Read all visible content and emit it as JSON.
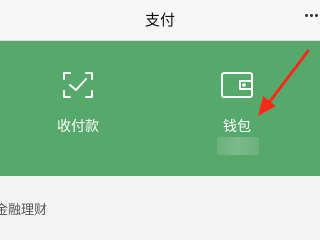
{
  "header": {
    "title": "支付",
    "more_icon": "more-dots-icon"
  },
  "colors": {
    "panel_background": "#57a86b",
    "arrow": "#ff2a1a"
  },
  "tiles": [
    {
      "label": "收付款",
      "icon": "scan-check-icon"
    },
    {
      "label": "钱包",
      "icon": "wallet-icon"
    }
  ],
  "list": {
    "section_label": "金融理财"
  }
}
